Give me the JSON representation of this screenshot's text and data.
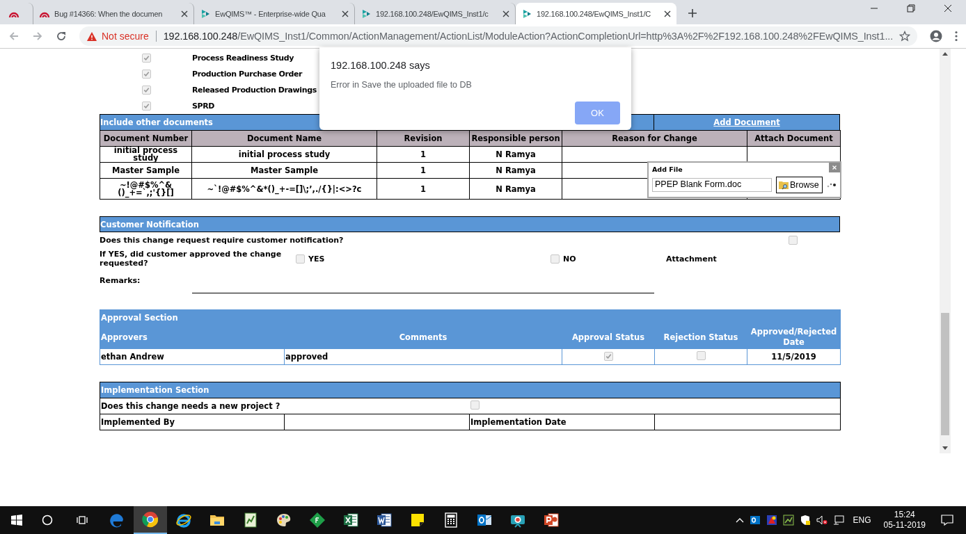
{
  "browser": {
    "tabs": [
      {
        "kind": "arc",
        "selected": false
      },
      {
        "kind": "arc",
        "title": "Bug #14366: When the documen",
        "selected": false
      },
      {
        "kind": "leaf",
        "title": "EwQIMS™ - Enterprise-wide Qua",
        "selected": false
      },
      {
        "kind": "leaf",
        "title": "192.168.100.248/EwQIMS_Inst1/c",
        "selected": false
      },
      {
        "kind": "leaf",
        "title": "192.168.100.248/EwQIMS_Inst1/C",
        "selected": true
      }
    ],
    "security": "Not secure",
    "host": "192.168.100.248",
    "path": "/EwQIMS_Inst1/Common/ActionManagement/ActionList/ModuleAction?ActionCompletionUrl=http%3A%2F%2F192.168.100.248%2FEwQIMS_Inst1..."
  },
  "checklist": [
    {
      "label": "Process Readiness Study",
      "checked": true
    },
    {
      "label": "Production Purchase Order",
      "checked": true
    },
    {
      "label": "Released Production Drawings",
      "checked": true
    },
    {
      "label": "SPRD",
      "checked": true
    }
  ],
  "other_documents": {
    "title": "Include other documents",
    "add_link": "Add Document",
    "columns": [
      "Document Number",
      "Document Name",
      "Revision",
      "Responsible person",
      "Reason for Change",
      "Attach Document"
    ],
    "rows": [
      [
        "initial process study",
        "initial process study",
        "1",
        "N Ramya"
      ],
      [
        "Master Sample",
        "Master Sample",
        "1",
        "N Ramya"
      ],
      [
        "~!@#$%^&()_+=`,;'{}[]",
        "~`!@#$%^&*()_+-=[]\\;’,./{}|:<>?c",
        "1",
        "N Ramya"
      ]
    ]
  },
  "add_file_popup": {
    "title": "Add File",
    "value": "PPEP Blank Form.doc",
    "button": "Browse"
  },
  "customer_notification": {
    "title": "Customer Notification",
    "question": "Does this change request require customer notification?",
    "notification_required": false,
    "approval_question": "If YES, did customer approved the change requested?",
    "options": [
      {
        "label": "YES",
        "checked": false
      },
      {
        "label": "NO",
        "checked": false
      }
    ],
    "attachment_label": "Attachment",
    "remarks_label": "Remarks:"
  },
  "approval": {
    "title": "Approval Section",
    "columns": [
      "Approvers",
      "Comments",
      "Approval Status",
      "Rejection Status",
      "Approved/Rejected Date"
    ],
    "rows": [
      {
        "approver": "ethan Andrew",
        "comment": "approved",
        "approved": true,
        "rejected": false,
        "date": "11/5/2019"
      }
    ]
  },
  "implementation": {
    "title": "Implementation Section",
    "question": "Does this change needs a new project ?",
    "new_project": false,
    "implemented_by_label": "Implemented By",
    "date_label": "Implementation Date"
  },
  "alert": {
    "title": "192.168.100.248 says",
    "message": "Error in Save the uploaded file to DB",
    "button": "OK"
  },
  "taskbar": {
    "apps": [
      {
        "kind": "edge",
        "selected": false
      },
      {
        "kind": "chrome",
        "selected": true
      },
      {
        "kind": "ie",
        "selected": false
      },
      {
        "kind": "folder",
        "selected": false
      },
      {
        "kind": "notepad",
        "selected": false
      },
      {
        "kind": "paint",
        "selected": false
      },
      {
        "kind": "diamond",
        "selected": false
      },
      {
        "kind": "excel",
        "selected": false
      },
      {
        "kind": "word",
        "selected": false
      },
      {
        "kind": "sticky",
        "selected": false
      },
      {
        "kind": "calculator",
        "selected": false
      },
      {
        "kind": "outlook",
        "selected": false
      },
      {
        "kind": "camera",
        "selected": false
      },
      {
        "kind": "powerpoint",
        "selected": false
      }
    ],
    "language": "ENG",
    "time": "15:24",
    "date": "05-11-2019"
  }
}
